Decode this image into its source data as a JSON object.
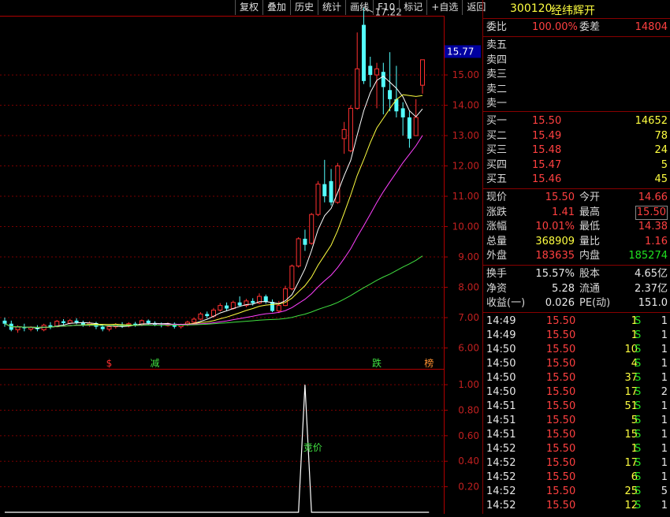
{
  "toolbar": [
    "复权",
    "叠加",
    "历史",
    "统计",
    "画线",
    "F10",
    "标记",
    "+自选",
    "返回"
  ],
  "chart_data": {
    "type": "candlestick",
    "y_ticks": [
      "15.00",
      "14.00",
      "13.00",
      "12.00",
      "11.00",
      "10.00",
      "9.00",
      "8.00",
      "7.00",
      "6.00"
    ],
    "ylim": [
      5.65,
      16.95
    ],
    "current_price_tag": "15.77",
    "high_annotation": "17.22",
    "candles": [
      {
        "o": 6.9,
        "c": 6.8,
        "h": 7.0,
        "l": 6.7
      },
      {
        "o": 6.8,
        "c": 6.6,
        "h": 6.9,
        "l": 6.55
      },
      {
        "o": 6.6,
        "c": 6.7,
        "h": 6.75,
        "l": 6.5
      },
      {
        "o": 6.7,
        "c": 6.65,
        "h": 6.8,
        "l": 6.55
      },
      {
        "o": 6.62,
        "c": 6.68,
        "h": 6.72,
        "l": 6.55
      },
      {
        "o": 6.68,
        "c": 6.62,
        "h": 6.75,
        "l": 6.55
      },
      {
        "o": 6.6,
        "c": 6.75,
        "h": 6.8,
        "l": 6.55
      },
      {
        "o": 6.75,
        "c": 6.7,
        "h": 6.85,
        "l": 6.62
      },
      {
        "o": 6.7,
        "c": 6.88,
        "h": 6.92,
        "l": 6.68
      },
      {
        "o": 6.88,
        "c": 6.82,
        "h": 6.95,
        "l": 6.75
      },
      {
        "o": 6.82,
        "c": 6.9,
        "h": 6.96,
        "l": 6.78
      },
      {
        "o": 6.9,
        "c": 6.84,
        "h": 6.98,
        "l": 6.78
      },
      {
        "o": 6.84,
        "c": 6.76,
        "h": 6.9,
        "l": 6.7
      },
      {
        "o": 6.76,
        "c": 6.82,
        "h": 6.88,
        "l": 6.7
      },
      {
        "o": 6.82,
        "c": 6.7,
        "h": 6.86,
        "l": 6.62
      },
      {
        "o": 6.7,
        "c": 6.62,
        "h": 6.76,
        "l": 6.55
      },
      {
        "o": 6.62,
        "c": 6.7,
        "h": 6.76,
        "l": 6.55
      },
      {
        "o": 6.7,
        "c": 6.78,
        "h": 6.82,
        "l": 6.64
      },
      {
        "o": 6.78,
        "c": 6.72,
        "h": 6.85,
        "l": 6.66
      },
      {
        "o": 6.72,
        "c": 6.8,
        "h": 6.85,
        "l": 6.68
      },
      {
        "o": 6.8,
        "c": 6.76,
        "h": 6.86,
        "l": 6.7
      },
      {
        "o": 6.76,
        "c": 6.9,
        "h": 6.94,
        "l": 6.72
      },
      {
        "o": 6.9,
        "c": 6.82,
        "h": 6.94,
        "l": 6.78
      },
      {
        "o": 6.82,
        "c": 6.78,
        "h": 6.88,
        "l": 6.72
      },
      {
        "o": 6.78,
        "c": 6.74,
        "h": 6.84,
        "l": 6.68
      },
      {
        "o": 6.74,
        "c": 6.8,
        "h": 6.84,
        "l": 6.7
      },
      {
        "o": 6.8,
        "c": 6.7,
        "h": 6.84,
        "l": 6.64
      },
      {
        "o": 6.7,
        "c": 6.76,
        "h": 6.8,
        "l": 6.64
      },
      {
        "o": 6.76,
        "c": 6.85,
        "h": 6.9,
        "l": 6.72
      },
      {
        "o": 6.85,
        "c": 6.95,
        "h": 7.0,
        "l": 6.8
      },
      {
        "o": 6.95,
        "c": 7.12,
        "h": 7.18,
        "l": 6.92
      },
      {
        "o": 7.12,
        "c": 7.05,
        "h": 7.2,
        "l": 6.98
      },
      {
        "o": 7.05,
        "c": 7.25,
        "h": 7.32,
        "l": 7.0
      },
      {
        "o": 7.25,
        "c": 7.4,
        "h": 7.48,
        "l": 7.2
      },
      {
        "o": 7.4,
        "c": 7.3,
        "h": 7.5,
        "l": 7.22
      },
      {
        "o": 7.3,
        "c": 7.5,
        "h": 7.56,
        "l": 7.26
      },
      {
        "o": 7.5,
        "c": 7.4,
        "h": 7.7,
        "l": 7.35
      },
      {
        "o": 7.4,
        "c": 7.55,
        "h": 7.62,
        "l": 7.34
      },
      {
        "o": 7.55,
        "c": 7.48,
        "h": 7.64,
        "l": 7.4
      },
      {
        "o": 7.48,
        "c": 7.7,
        "h": 7.8,
        "l": 7.44
      },
      {
        "o": 7.7,
        "c": 7.52,
        "h": 7.76,
        "l": 7.46
      },
      {
        "o": 7.52,
        "c": 7.22,
        "h": 7.6,
        "l": 7.18
      },
      {
        "o": 7.22,
        "c": 7.4,
        "h": 7.55,
        "l": 7.15
      },
      {
        "o": 7.4,
        "c": 7.95,
        "h": 8.05,
        "l": 7.38
      },
      {
        "o": 7.95,
        "c": 8.7,
        "h": 8.75,
        "l": 7.9
      },
      {
        "o": 8.7,
        "c": 9.6,
        "h": 9.65,
        "l": 8.65
      },
      {
        "o": 9.6,
        "c": 9.4,
        "h": 9.9,
        "l": 9.2
      },
      {
        "o": 9.45,
        "c": 10.4,
        "h": 10.45,
        "l": 9.4
      },
      {
        "o": 10.4,
        "c": 11.4,
        "h": 11.5,
        "l": 10.35
      },
      {
        "o": 11.4,
        "c": 11.0,
        "h": 12.2,
        "l": 10.8
      },
      {
        "o": 11.5,
        "c": 10.8,
        "h": 11.9,
        "l": 10.7
      },
      {
        "o": 10.8,
        "c": 12.0,
        "h": 12.1,
        "l": 10.75
      },
      {
        "o": 12.9,
        "c": 13.2,
        "h": 13.45,
        "l": 12.4
      },
      {
        "o": 12.5,
        "c": 13.9,
        "h": 14.0,
        "l": 12.45
      },
      {
        "o": 13.9,
        "c": 15.2,
        "h": 16.4,
        "l": 13.85
      },
      {
        "o": 16.65,
        "c": 14.8,
        "h": 17.22,
        "l": 14.7
      },
      {
        "o": 15.3,
        "c": 15.0,
        "h": 15.6,
        "l": 14.6
      },
      {
        "o": 15.0,
        "c": 15.2,
        "h": 15.4,
        "l": 13.9
      },
      {
        "o": 15.1,
        "c": 14.6,
        "h": 15.4,
        "l": 13.7
      },
      {
        "o": 14.5,
        "c": 14.2,
        "h": 15.75,
        "l": 13.8
      },
      {
        "o": 14.2,
        "c": 13.8,
        "h": 15.3,
        "l": 13.6
      },
      {
        "o": 13.9,
        "c": 13.6,
        "h": 14.1,
        "l": 13.0
      },
      {
        "o": 13.6,
        "c": 12.9,
        "h": 13.8,
        "l": 12.6
      },
      {
        "o": 13.0,
        "c": 13.6,
        "h": 14.2,
        "l": 13.1
      },
      {
        "o": 14.66,
        "c": 15.5,
        "h": 15.5,
        "l": 14.38
      }
    ],
    "markers": [
      {
        "idx": 16,
        "text": "$",
        "color": "#ff3030"
      },
      {
        "idx": 23,
        "text": "减",
        "color": "#40e040"
      },
      {
        "idx": 57,
        "text": "跌",
        "color": "#40e040"
      },
      {
        "idx": 65,
        "text": "榜",
        "color": "#ff9030"
      }
    ],
    "sub_y_ticks": [
      "1.00",
      "0.80",
      "0.60",
      "0.40",
      "0.20"
    ],
    "sub_ylim": [
      0,
      1.05
    ],
    "sub_label": "竞价",
    "sub_values": [
      0,
      0,
      0,
      0,
      0,
      0,
      0,
      0,
      0,
      0,
      0,
      0,
      0,
      0,
      0,
      0,
      0,
      0,
      0,
      0,
      0,
      0,
      0,
      0,
      0,
      0,
      0,
      0,
      0,
      0,
      0,
      0,
      0,
      0,
      0,
      0,
      0,
      0,
      0,
      0,
      0,
      0,
      0,
      0,
      0,
      0,
      1,
      0,
      0,
      0,
      0,
      0,
      0,
      0,
      0,
      0,
      0,
      0,
      0,
      0,
      0,
      0,
      0,
      0,
      0,
      0
    ]
  },
  "quote": {
    "code": "300120",
    "name": "经纬辉开",
    "weibi_label": "委比",
    "weibi": "100.00%",
    "weicha_label": "委差",
    "weicha": "14804",
    "asks": [
      "卖五",
      "卖四",
      "卖三",
      "卖二",
      "卖一"
    ],
    "bids": [
      {
        "label": "买一",
        "price": "15.50",
        "vol": "14652"
      },
      {
        "label": "买二",
        "price": "15.49",
        "vol": "78"
      },
      {
        "label": "买三",
        "price": "15.48",
        "vol": "24"
      },
      {
        "label": "买四",
        "price": "15.47",
        "vol": "5"
      },
      {
        "label": "买五",
        "price": "15.46",
        "vol": "45"
      }
    ],
    "stats": [
      {
        "l1": "现价",
        "v1": "15.50",
        "c1": "red",
        "l2": "今开",
        "v2": "14.66",
        "c2": "red"
      },
      {
        "l1": "涨跌",
        "v1": "1.41",
        "c1": "red",
        "l2": "最高",
        "v2": "15.50",
        "c2": "red"
      },
      {
        "l1": "涨幅",
        "v1": "10.01%",
        "c1": "red",
        "l2": "最低",
        "v2": "14.38",
        "c2": "red"
      },
      {
        "l1": "总量",
        "v1": "368909",
        "c1": "yellow",
        "l2": "量比",
        "v2": "1.16",
        "c2": "red"
      },
      {
        "l1": "外盘",
        "v1": "183635",
        "c1": "red",
        "l2": "内盘",
        "v2": "185274",
        "c2": "green"
      }
    ],
    "stats2": [
      {
        "l1": "换手",
        "v1": "15.57%",
        "l2": "股本",
        "v2": "4.65亿"
      },
      {
        "l1": "净资",
        "v1": "5.28",
        "l2": "流通",
        "v2": "2.37亿"
      },
      {
        "l1": "收益(一)",
        "v1": "0.026",
        "l2": "PE(动)",
        "v2": "151.0"
      }
    ],
    "ticks": [
      {
        "t": "14:49",
        "p": "15.50",
        "v": "1",
        "d": "S",
        "n": "1"
      },
      {
        "t": "14:49",
        "p": "15.50",
        "v": "1",
        "d": "S",
        "n": "1"
      },
      {
        "t": "14:50",
        "p": "15.50",
        "v": "10",
        "d": "S",
        "n": "1"
      },
      {
        "t": "14:50",
        "p": "15.50",
        "v": "4",
        "d": "S",
        "n": "1"
      },
      {
        "t": "14:50",
        "p": "15.50",
        "v": "37",
        "d": "S",
        "n": "1"
      },
      {
        "t": "14:50",
        "p": "15.50",
        "v": "17",
        "d": "S",
        "n": "2"
      },
      {
        "t": "14:51",
        "p": "15.50",
        "v": "51",
        "d": "S",
        "n": "1"
      },
      {
        "t": "14:51",
        "p": "15.50",
        "v": "5",
        "d": "S",
        "n": "1"
      },
      {
        "t": "14:51",
        "p": "15.50",
        "v": "15",
        "d": "S",
        "n": "1"
      },
      {
        "t": "14:52",
        "p": "15.50",
        "v": "1",
        "d": "S",
        "n": "1"
      },
      {
        "t": "14:52",
        "p": "15.50",
        "v": "17",
        "d": "S",
        "n": "1"
      },
      {
        "t": "14:52",
        "p": "15.50",
        "v": "6",
        "d": "S",
        "n": "1"
      },
      {
        "t": "14:52",
        "p": "15.50",
        "v": "25",
        "d": "S",
        "n": "5"
      },
      {
        "t": "14:52",
        "p": "15.50",
        "v": "12",
        "d": "S",
        "n": "1"
      }
    ]
  }
}
